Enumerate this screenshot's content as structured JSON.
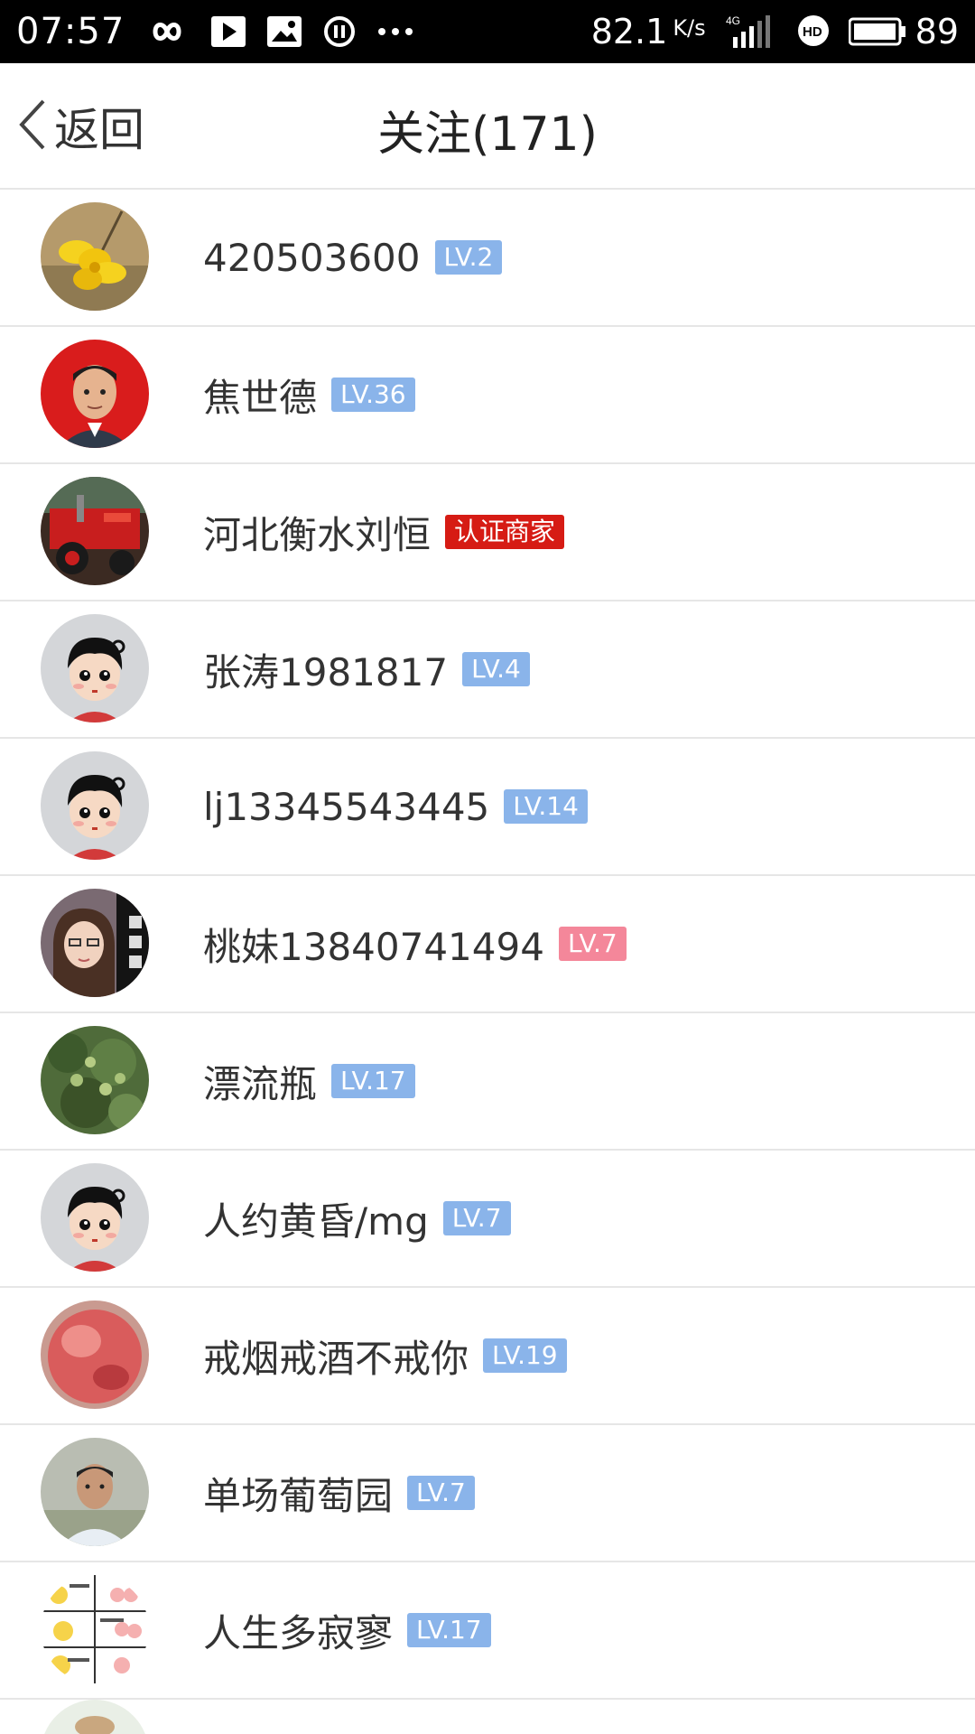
{
  "status_bar": {
    "time": "07:57",
    "speed": "82.1",
    "speed_unit": "K/s",
    "network": "4G",
    "battery": "89",
    "icons": [
      "infinity-icon",
      "play-icon",
      "image-icon",
      "pause-circle-icon",
      "more-dots-icon",
      "signal-icon",
      "hd-icon",
      "battery-icon"
    ]
  },
  "header": {
    "back_label": "返回",
    "title": "关注(171)"
  },
  "follow_list": [
    {
      "name": "420503600",
      "badge": "LV.2",
      "badge_type": "blue",
      "avatar": "flower"
    },
    {
      "name": "焦世德",
      "badge": "LV.36",
      "badge_type": "blue",
      "avatar": "man-red"
    },
    {
      "name": "河北衡水刘恒",
      "badge": "认证商家",
      "badge_type": "red",
      "avatar": "machine"
    },
    {
      "name": "张涛1981817",
      "badge": "LV.4",
      "badge_type": "blue",
      "avatar": "cartoon"
    },
    {
      "name": "lj13345543445",
      "badge": "LV.14",
      "badge_type": "blue",
      "avatar": "cartoon"
    },
    {
      "name": "桃妹13840741494",
      "badge": "LV.7",
      "badge_type": "pink",
      "avatar": "woman"
    },
    {
      "name": "漂流瓶",
      "badge": "LV.17",
      "badge_type": "blue",
      "avatar": "tree"
    },
    {
      "name": "人约黄昏/mg",
      "badge": "LV.7",
      "badge_type": "blue",
      "avatar": "cartoon"
    },
    {
      "name": "戒烟戒酒不戒你",
      "badge": "LV.19",
      "badge_type": "blue",
      "avatar": "peach"
    },
    {
      "name": "单场葡萄园",
      "badge": "LV.7",
      "badge_type": "blue",
      "avatar": "man-outdoor"
    },
    {
      "name": "人生多寂寥",
      "badge": "LV.17",
      "badge_type": "blue",
      "avatar": "comic"
    }
  ],
  "colors": {
    "badge_blue": "#8ab4ea",
    "badge_pink": "#f4879a",
    "badge_red": "#d61b14",
    "divider": "#e6e6e6"
  }
}
